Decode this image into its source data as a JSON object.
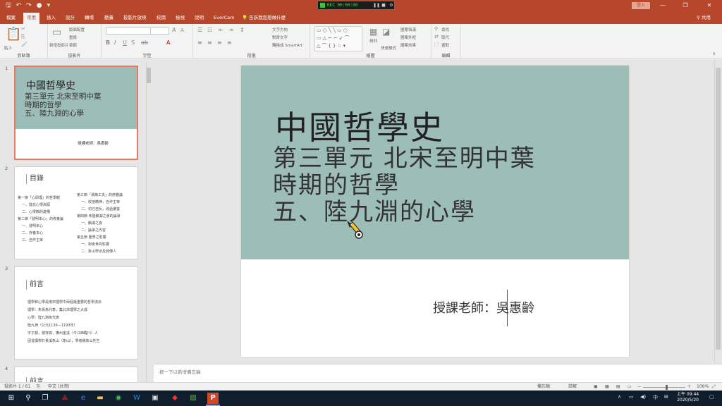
{
  "titlebar": {
    "recorder_label": "REC 00:00:00",
    "login_label": "登入",
    "controls": [
      "—",
      "❐",
      "✕"
    ]
  },
  "tabs": [
    {
      "label": "檔案",
      "active": false
    },
    {
      "label": "常用",
      "active": true
    },
    {
      "label": "插入",
      "active": false
    },
    {
      "label": "設計",
      "active": false
    },
    {
      "label": "轉場",
      "active": false
    },
    {
      "label": "動畫",
      "active": false
    },
    {
      "label": "投影片放映",
      "active": false
    },
    {
      "label": "校閱",
      "active": false
    },
    {
      "label": "檢視",
      "active": false
    },
    {
      "label": "說明",
      "active": false
    },
    {
      "label": "EverCam",
      "active": false
    }
  ],
  "tell_me": "告訴我您想做什麼",
  "share_label": "共用",
  "ribbon": {
    "clipboard": {
      "label": "剪貼簿",
      "paste": "貼上"
    },
    "slides": {
      "label": "投影片",
      "new_slide": "新增投影片",
      "layout": "版面配置",
      "reset": "重設",
      "section": "章節"
    },
    "font": {
      "label": "字型"
    },
    "paragraph": {
      "label": "段落",
      "text_direction": "文字方向",
      "align_text": "對齊文字",
      "smartart": "轉換成 SmartArt"
    },
    "drawing": {
      "label": "繪圖",
      "arrange": "排列",
      "quick_styles": "快速樣式",
      "fill": "圖案填滿",
      "outline": "圖案外框",
      "effects": "圖案效果"
    },
    "editing": {
      "label": "編輯",
      "find": "尋找",
      "replace": "取代",
      "select": "選取"
    }
  },
  "thumbnails": [
    {
      "number": "1",
      "title": "中國哲學史",
      "subtitle_lines": [
        "第三單元  北宋至明中葉",
        "時期的哲學",
        "五、陸九淵的心學"
      ],
      "teacher": "授課老師：吳惠齡"
    },
    {
      "number": "2",
      "heading": "目錄",
      "left_lines": [
        "第一節「心即理」的哲學觀",
        "一、陸氏心學淵源",
        "二、心學觀的建構",
        "第二節「發明本心」的修養論",
        "一、發明本心",
        "二、存養本心",
        "三、自作主宰"
      ],
      "right_lines": [
        "第三節「易簡工夫」的修養論",
        "一、收拾精神，自作主宰",
        "二、切己自反，改過遷善",
        "第四節 朱陸鵝湖之會的論爭",
        "一、鵝湖之會",
        "二、論爭之內容",
        "第五節 陸學之影響",
        "一、對後世的影響",
        "二、象山學派及其傳人"
      ]
    },
    {
      "number": "3",
      "heading": "前言",
      "lines": [
        "理學和心學是南宋理學中兩個最重要的哲學流派",
        "理學：朱熹為代表，集北宋理學之大成",
        "心學：陸九淵為代表",
        "陸九淵（公元1139—1193年）",
        "字子靜，號存齋，撫州金溪（今江西臨川）人",
        "因曾講學於貴溪象山（象山），學者稱象山先生"
      ]
    },
    {
      "number": "4",
      "heading": "前言"
    }
  ],
  "slide": {
    "title": "中國哲學史",
    "subtitle_lines": [
      "第三單元  北宋至明中葉",
      "時期的哲學",
      "五、陸九淵的心學"
    ],
    "teacher": "授課老師：吳惠齡"
  },
  "notes_placeholder": "按一下以新增備忘稿",
  "status": {
    "slide_count": "投影片 1 / 61",
    "language": "中文 (台灣)",
    "notes": "備忘稿",
    "comments": "註解",
    "zoom": "106%"
  },
  "clock": {
    "time": "上午 09:44",
    "date": "2020/5/20"
  },
  "colors": {
    "accent": "#b7472a",
    "slide_band": "#9dbdb8",
    "taskbar": "#101d2c"
  }
}
